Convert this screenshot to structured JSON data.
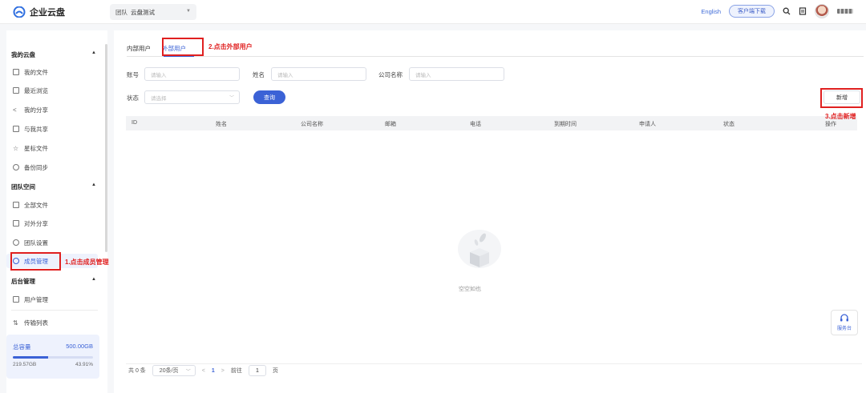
{
  "header": {
    "app_name": "企业云盘",
    "team_label": "团队",
    "team_value": "云盘测试",
    "lang": "English",
    "download_label": "客户端下载"
  },
  "sidebar": {
    "sections": [
      {
        "title": "我的云盘",
        "items": [
          "我的文件",
          "最近浏览",
          "我的分享",
          "与我共享",
          "星标文件",
          "备份同步"
        ]
      },
      {
        "title": "团队空间",
        "items": [
          "全部文件",
          "对外分享",
          "团队设置",
          "成员管理"
        ]
      },
      {
        "title": "后台管理",
        "items": [
          "用户管理"
        ]
      }
    ],
    "transfer": "传输列表",
    "storage": {
      "label": "总容量",
      "total": "500.00GB",
      "used": "219.57GB",
      "percent": "43.91%",
      "fraction": 0.4391
    }
  },
  "tabs": [
    "内部用户",
    "外部用户"
  ],
  "filters": {
    "account_label": "账号",
    "account_placeholder": "请输入",
    "name_label": "姓名",
    "name_placeholder": "请输入",
    "company_label": "公司名称",
    "company_placeholder": "请输入",
    "status_label": "状态",
    "status_placeholder": "请选择",
    "query_button": "查询"
  },
  "add_button": "新增",
  "table": {
    "columns": [
      "ID",
      "姓名",
      "公司名称",
      "邮箱",
      "电话",
      "到期时间",
      "申请人",
      "状态",
      "操作"
    ],
    "empty_text": "空空如也"
  },
  "pagination": {
    "total": "共 0 条",
    "page_size": "20条/页",
    "current_page": "1",
    "goto_label": "前往",
    "goto_value": "1",
    "page_suffix": "页"
  },
  "service_label": "服务台",
  "annotations": {
    "step1": "1.点击成员管理",
    "step2": "2.点击外部用户",
    "step3": "3.点击新增"
  },
  "colors": {
    "accent": "#3b62d6",
    "annotation": "#e02020"
  }
}
